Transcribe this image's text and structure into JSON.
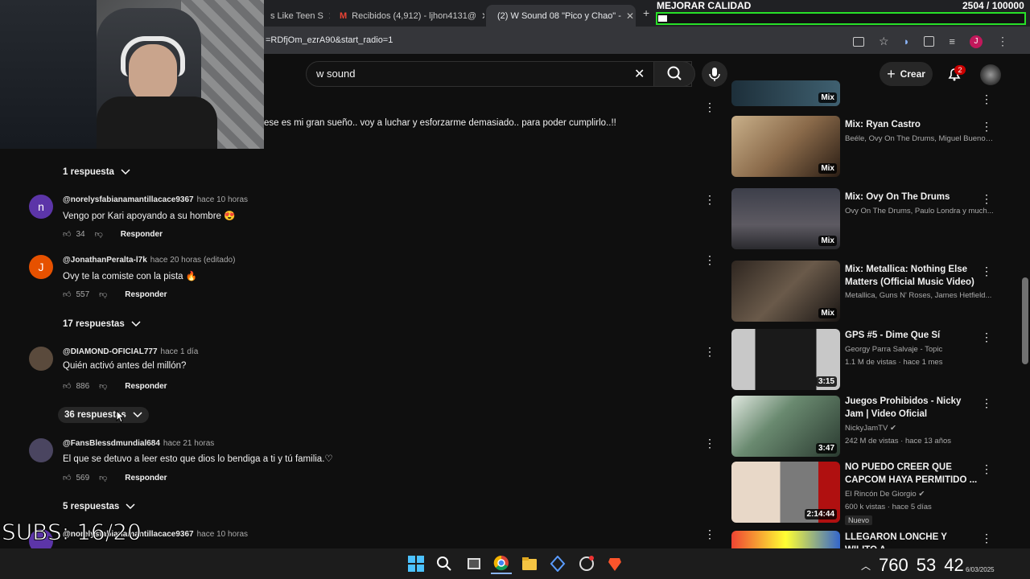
{
  "browser": {
    "tabs": [
      {
        "label": "s Like Teen S",
        "active": false
      },
      {
        "label": "Recibidos (4,912) - ljhon4131@",
        "active": false
      },
      {
        "label": "(2) W Sound 08 \"Pico y Chao\" -",
        "active": true
      }
    ],
    "url": "=RDfjOm_ezrA90&start_radio=1"
  },
  "overlay": {
    "quality_label": "MEJORAR CALIDAD",
    "quality_count": "2504 / 100000",
    "quality_progress": 0.025,
    "subs": "SUBS: 16/20"
  },
  "youtube": {
    "search_value": "w sound",
    "create_label": "Crear",
    "notif_count": "2"
  },
  "comments": {
    "top_text": "ese es mi gran sueño.. voy a luchar y esforzarme demasiado.. para poder cumplirlo..!!",
    "reply_label": "Responder",
    "items": [
      {
        "replies_before": "1 respuesta",
        "avatar_letter": "n",
        "avatar_color": "#5c35a8",
        "author": "@norelysfabianamantillacace9367",
        "time": "hace 10 horas",
        "text": "Vengo por Kari apoyando a su hombre 😍",
        "likes": "34"
      },
      {
        "avatar_letter": "J",
        "avatar_color": "#e65100",
        "author": "@JonathanPeralta-l7k",
        "time": "hace 20 horas (editado)",
        "text": "Ovy te la comiste con la pista 🔥",
        "likes": "557",
        "replies_after": "17 respuestas"
      },
      {
        "avatar_letter": "",
        "avatar_color": "#5a4a3c",
        "author": "@DIAMOND-OFICIAL777",
        "time": "hace 1 día",
        "text": "Quién activó antes del millón?",
        "likes": "886",
        "replies_after": "36 respuestas"
      },
      {
        "avatar_letter": "",
        "avatar_color": "#4a4560",
        "author": "@FansBlessdmundial684",
        "time": "hace 21 horas",
        "text": "El que se detuvo a leer esto que dios lo bendiga a ti y tú familia.♡",
        "likes": "569",
        "replies_after": "5 respuestas"
      },
      {
        "avatar_letter": "",
        "avatar_color": "#5c35a8",
        "author": "@norelysfabianamantillacace9367",
        "time": "hace 10 horas",
        "text": "",
        "likes": ""
      }
    ]
  },
  "sidebar": {
    "videos": [
      {
        "title": "",
        "meta1": "",
        "meta2": "",
        "badge": "Mix"
      },
      {
        "title": "Mix: Ryan Castro",
        "meta1": "Beéle, Ovy On The Drums, Miguel Bueno ...",
        "meta2": "",
        "badge": "Mix"
      },
      {
        "title": "Mix: Ovy On The Drums",
        "meta1": "Ovy On The Drums, Paulo Londra y much...",
        "meta2": "",
        "badge": "Mix"
      },
      {
        "title": "Mix: Metallica: Nothing Else Matters (Official Music Video)",
        "meta1": "Metallica, Guns N' Roses, James Hetfield...",
        "meta2": "",
        "badge": "Mix"
      },
      {
        "title": "GPS #5 - Dime Que Sí",
        "meta1": "Georgy Parra Salvaje - Topic",
        "meta2": "1.1 M de vistas · hace 1 mes",
        "badge": "3:15"
      },
      {
        "title": "Juegos Prohibidos - Nicky Jam | Video Oficial",
        "meta1": "NickyJamTV",
        "meta2": "242 M de vistas · hace 13 años",
        "badge": "3:47"
      },
      {
        "title": "NO PUEDO CREER QUE CAPCOM HAYA PERMITIDO ...",
        "meta1": "El Rincón De Giorgio",
        "meta2": "600 k vistas · hace 5 días",
        "badge": "2:14:44",
        "tag": "Nuevo"
      },
      {
        "title": "LLEGARON LONCHE Y WILITO A",
        "meta1": "",
        "meta2": "",
        "badge": ""
      }
    ]
  },
  "taskbar": {
    "tray_num1": "760",
    "tray_num2": "53",
    "tray_num3": "42",
    "date": "6/03/2025"
  }
}
